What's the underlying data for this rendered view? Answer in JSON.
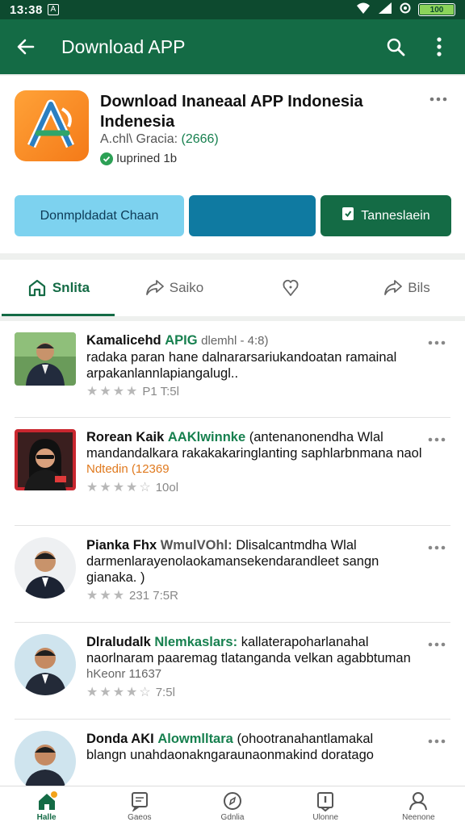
{
  "status_bar": {
    "time": "13:38",
    "sim": "A",
    "battery": "100",
    "battery_level": 1.0
  },
  "app_bar": {
    "title": "Download APP",
    "back_icon": "arrow-left-icon",
    "search_icon": "search-icon",
    "menu_icon": "more-vertical-icon"
  },
  "app_card": {
    "name": "Download Inaneaal APP Indonesia Indenesia",
    "meta_prefix": "A.chl\\ Gracia:",
    "meta_count": "(2666)",
    "verified": "Iuprined 1b",
    "buttons": {
      "primary": "Donmpldadat Chaan",
      "secondary": "",
      "install": "Tanneslaein"
    }
  },
  "tabs": [
    {
      "label": "Snlita",
      "icon": "home-icon"
    },
    {
      "label": "Saiko",
      "icon": "share-icon"
    },
    {
      "label": "",
      "icon": "heart-icon"
    },
    {
      "label": "Bils",
      "icon": "share-icon"
    }
  ],
  "feed": [
    {
      "author": "Kamalicehd",
      "tag": "APIG",
      "tag_color": "#17804f",
      "after": "dlemhl - 4:8)",
      "text": "radaka paran hane dalnararsariukandoatan ramainal arpakanlannlapiangalugl..",
      "sub": "",
      "rating_text": "P1   T:5l",
      "stars_filled": 4
    },
    {
      "author": "Rorean Kaik",
      "tag": "AAKlwinnke",
      "tag_color": "#17804f",
      "after": "(antenanonendha Wlal",
      "text": "mandandalkara rakakakaringlanting saphlarbnmana naol",
      "sub": "Ndtedin (12369",
      "rating_text": "10ol",
      "stars_filled": 4
    },
    {
      "author": "Pianka Fhx",
      "tag": "WmulVOhl:",
      "tag_color": "#555555",
      "after": "Dlisalcantmdha Wlal",
      "text": "darmenlarayenolaokamansekendarandleet sangn gianaka. )",
      "sub": "",
      "rating_text": "231 7:5R",
      "stars_filled": 3
    },
    {
      "author": "Dlraludalk",
      "tag": "Nlemkaslars:",
      "tag_color": "#17804f",
      "after": "kallaterapoharlanahal",
      "text": "naorlnaram paaremag tlatanganda velkan agabbtuman",
      "sub": "hKeonr 11637",
      "rating_text": "7:5l",
      "stars_filled": 4
    },
    {
      "author": "Donda AKI",
      "tag": "Alowmlltara",
      "tag_color": "#17804f",
      "after": "(ohootranahantlamakal",
      "text": "blangn unahdaonakngaraunaonmakind doratago",
      "sub": "",
      "rating_text": "",
      "stars_filled": 0
    }
  ],
  "bottom_nav": [
    {
      "label": "Halle",
      "icon": "home-icon"
    },
    {
      "label": "Gaeos",
      "icon": "chat-icon"
    },
    {
      "label": "Gdnlia",
      "icon": "compass-icon"
    },
    {
      "label": "Ulonne",
      "icon": "alert-icon"
    },
    {
      "label": "Neenone",
      "icon": "profile-icon"
    }
  ],
  "colors": {
    "primary": "#146b45",
    "accent_blue": "#7dd2ef",
    "deep_blue": "#0f7aa1"
  }
}
